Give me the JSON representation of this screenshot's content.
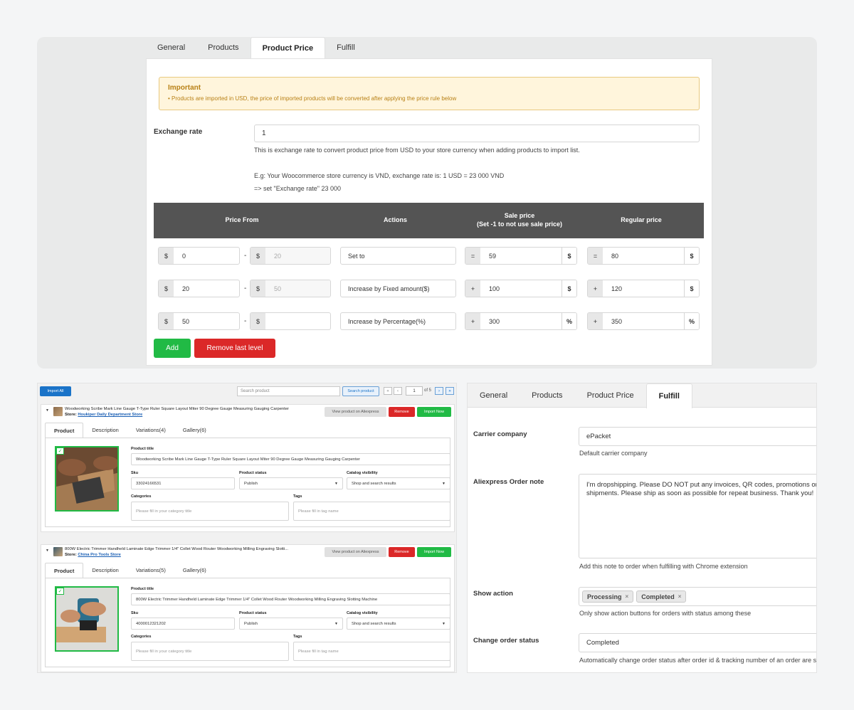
{
  "top": {
    "tabs": [
      "General",
      "Products",
      "Product Price",
      "Fulfill"
    ],
    "notice": {
      "title": "Important",
      "text": "•  Products are imported in USD, the price of imported products will be converted after applying the price rule below"
    },
    "exchange": {
      "label": "Exchange rate",
      "value": "1",
      "help1": "This is exchange rate to convert product price from USD to your store currency when adding products to import list.",
      "help2": "E.g: Your Woocommerce store currency is VND, exchange rate is: 1 USD = 23 000 VND",
      "help3": "=> set \"Exchange rate\" 23 000"
    },
    "table_head": {
      "price_from": "Price From",
      "actions": "Actions",
      "sale_price": "Sale price",
      "sale_note": "(Set -1 to not use sale price)",
      "regular_price": "Regular price"
    },
    "rules": [
      {
        "currency": "$",
        "from": "0",
        "to": "20",
        "action": "Set to",
        "sale_op": "=",
        "sale": "59",
        "sale_unit": "$",
        "reg_op": "=",
        "regular": "80",
        "reg_unit": "$"
      },
      {
        "currency": "$",
        "from": "20",
        "to": "50",
        "action": "Increase by Fixed amount($)",
        "sale_op": "+",
        "sale": "100",
        "sale_unit": "$",
        "reg_op": "+",
        "regular": "120",
        "reg_unit": "$"
      },
      {
        "currency": "$",
        "from": "50",
        "to": "",
        "action": "Increase by Percentage(%)",
        "sale_op": "+",
        "sale": "300",
        "sale_unit": "%",
        "reg_op": "+",
        "regular": "350",
        "reg_unit": "%"
      }
    ],
    "dash": "-",
    "add_label": "Add",
    "remove_label": "Remove last level"
  },
  "list": {
    "import_all": "Import All",
    "search_placeholder": "Search product",
    "search_button": "Search product",
    "page_first": "«",
    "page_prev": "‹",
    "page_value": "1",
    "page_of": "of 5",
    "page_next": "›",
    "page_last": "»",
    "view_label": "View product on Aliexpress",
    "remove_label": "Remove",
    "import_label": "Import Now",
    "tabs": [
      "Product",
      "Description"
    ],
    "field_labels": {
      "title": "Product title",
      "sku": "Sku",
      "status": "Product status",
      "visibility": "Catalog visibility",
      "categories": "Categories",
      "tags": "Tags"
    },
    "categories_placeholder": "Please fill in your category title",
    "tags_placeholder": "Please fill in tag name",
    "check": "✓",
    "products": [
      {
        "name": "Woodworking Scribe Mark Line Gauge T-Type Ruler Square Layout Miter 90 Degree Gauge Measuring Gauging Carpenter",
        "store_label": "Store:",
        "store": "Houkiper Daily Department Store",
        "variations": "Variations(4)",
        "gallery": "Gallery(6)",
        "title": "Woodworking Scribe Mark Line Gauge T-Type Ruler Square Layout Miter 90 Degree Gauge Measuring Gauging Carpenter",
        "sku": "33024166531",
        "status": "Publish",
        "visibility": "Shop and search results"
      },
      {
        "name": "800W Electric Trimmer Handheld Laminate Edge Trimmer 1/4\" Collet Wood Router Woodworking Milling Engraving Slotti...",
        "store_label": "Store:",
        "store": "China Pro Tools Store",
        "variations": "Variations(5)",
        "gallery": "Gallery(6)",
        "title": "800W Electric Trimmer Handheld Laminate Edge Trimmer 1/4\" Collet Wood Router Woodworking Milling Engraving Slotting Machine",
        "sku": "4000012321202",
        "status": "Publish",
        "visibility": "Shop and search results"
      }
    ]
  },
  "fulfill": {
    "tabs": [
      "General",
      "Products",
      "Product Price",
      "Fulfill"
    ],
    "carrier_label": "Carrier company",
    "carrier_value": "ePacket",
    "carrier_help": "Default carrier company",
    "note_label": "Aliexpress Order note",
    "note_value": "I'm dropshipping. Please DO NOT put any invoices, QR codes, promotions or your brand name logo in the shipments. Please ship as soon as possible for repeat business. Thank you!",
    "note_help": "Add this note to order when fulfilling with Chrome extension",
    "action_label": "Show action",
    "chips": [
      "Processing",
      "Completed"
    ],
    "chip_x": "×",
    "action_help": "Only show action buttons for orders with status among these",
    "status_label": "Change order status",
    "status_value": "Completed",
    "status_help": "Automatically change order status after order id & tracking number of an order are synced"
  },
  "colors": {
    "green": "#21ba45",
    "red": "#db2828",
    "blue": "#1a73c8",
    "header_dark": "#545454",
    "notice_bg": "#fff5dc",
    "notice_text": "#b88015"
  }
}
